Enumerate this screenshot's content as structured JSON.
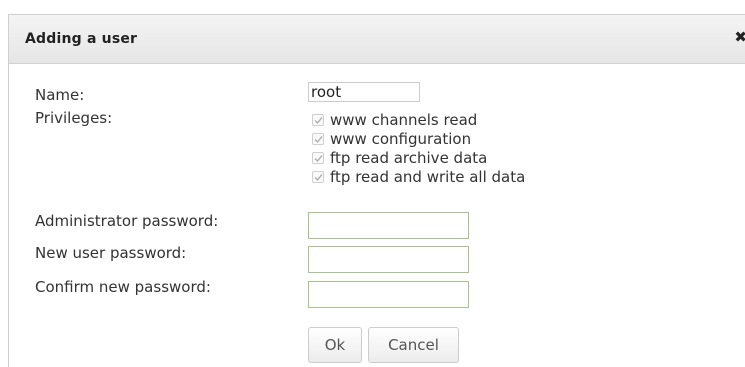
{
  "dialog": {
    "title": "Adding a user",
    "close_icon": "close-icon"
  },
  "form": {
    "name_label": "Name:",
    "name_value": "root",
    "privileges_label": "Privileges:",
    "privileges": [
      {
        "label": "www channels read",
        "checked": true,
        "disabled": true
      },
      {
        "label": "www configuration",
        "checked": true,
        "disabled": true
      },
      {
        "label": "ftp read archive data",
        "checked": true,
        "disabled": true
      },
      {
        "label": "ftp read and write all data",
        "checked": true,
        "disabled": true
      }
    ],
    "admin_password_label": "Administrator password:",
    "new_password_label": "New user password:",
    "confirm_password_label": "Confirm new password:"
  },
  "buttons": {
    "ok_label": "Ok",
    "cancel_label": "Cancel"
  },
  "colors": {
    "input_border": "#a8c28a",
    "titlebar": "#e8e8e8"
  }
}
